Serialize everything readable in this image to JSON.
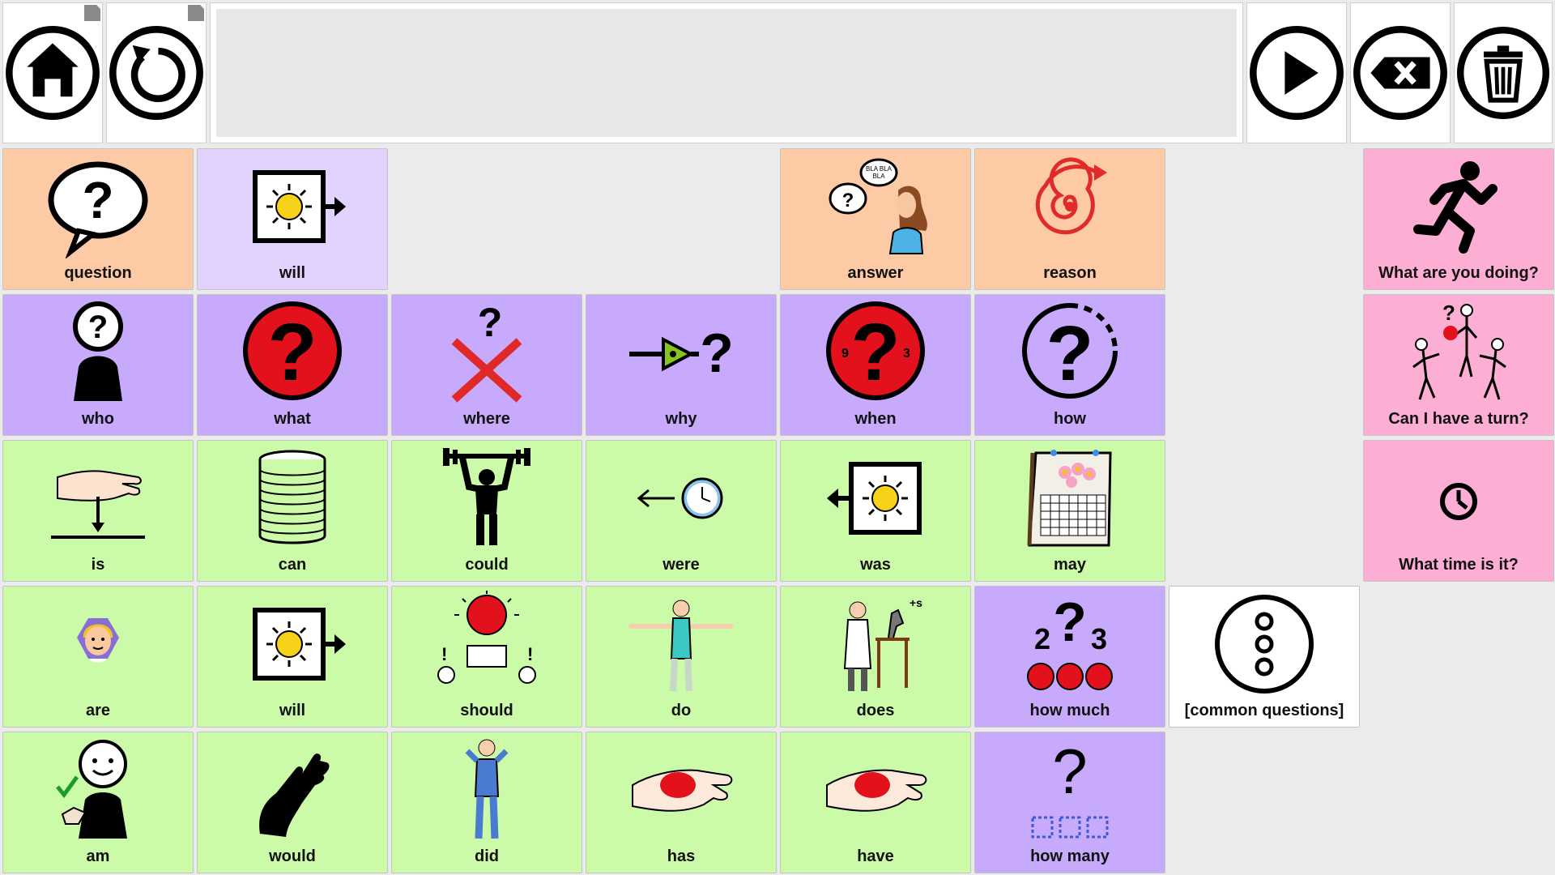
{
  "toolbar": {
    "home": "home-icon",
    "undo": "undo-icon",
    "speak": "play-icon",
    "backspace": "backspace-icon",
    "clear": "trash-icon"
  },
  "message": {
    "text": ""
  },
  "colors": {
    "orange": "#fdcaa6",
    "lilac": "#e2d3fe",
    "purple": "#c8aafd",
    "green": "#cbfba9",
    "pink": "#fdaed4",
    "white": "#ffffff"
  },
  "grid": [
    {
      "label": "question",
      "icon": "speech-bubble-question-icon",
      "color": "orange"
    },
    {
      "label": "will",
      "icon": "sun-future-arrow-icon",
      "color": "lilac"
    },
    {
      "label": "answer",
      "icon": "girl-answer-icon",
      "color": "orange"
    },
    {
      "label": "reason",
      "icon": "spiral-icon",
      "color": "orange"
    },
    {
      "label": "What are you doing?",
      "icon": "running-person-icon",
      "color": "pink"
    },
    {
      "label": "who",
      "icon": "person-question-icon",
      "color": "purple"
    },
    {
      "label": "what",
      "icon": "red-question-icon",
      "color": "purple"
    },
    {
      "label": "where",
      "icon": "cross-question-icon",
      "color": "purple"
    },
    {
      "label": "why",
      "icon": "reason-arrow-question-icon",
      "color": "purple"
    },
    {
      "label": "when",
      "icon": "clock-question-icon",
      "color": "purple"
    },
    {
      "label": "how",
      "icon": "dashed-question-icon",
      "color": "purple"
    },
    {
      "label": "Can I have a turn?",
      "icon": "ball-turn-icon",
      "color": "pink"
    },
    {
      "label": "is",
      "icon": "hand-drop-icon",
      "color": "green"
    },
    {
      "label": "can",
      "icon": "can-stack-icon",
      "color": "green"
    },
    {
      "label": "could",
      "icon": "weightlifter-icon",
      "color": "green"
    },
    {
      "label": "were",
      "icon": "clock-past-arrow-icon",
      "color": "green"
    },
    {
      "label": "was",
      "icon": "sun-past-arrow-icon",
      "color": "green"
    },
    {
      "label": "may",
      "icon": "calendar-icon",
      "color": "green"
    },
    {
      "label": "What time is it?",
      "icon": "clock-icon",
      "color": "pink"
    },
    {
      "label": "are",
      "icon": "person-arms-up-icon",
      "color": "green"
    },
    {
      "label": "will",
      "icon": "sun-future-arrow-icon",
      "color": "green"
    },
    {
      "label": "should",
      "icon": "should-people-icon",
      "color": "green"
    },
    {
      "label": "do",
      "icon": "gymnast-icon",
      "color": "green"
    },
    {
      "label": "does",
      "icon": "scientist-icon",
      "color": "green"
    },
    {
      "label": "how much",
      "icon": "how-much-icon",
      "color": "purple"
    },
    {
      "label": "[common questions]",
      "icon": "more-dots-icon",
      "color": "white"
    },
    {
      "label": "am",
      "icon": "person-self-icon",
      "color": "green"
    },
    {
      "label": "would",
      "icon": "hand-icon",
      "color": "green"
    },
    {
      "label": "did",
      "icon": "standing-man-icon",
      "color": "green"
    },
    {
      "label": "has",
      "icon": "hand-ball-icon",
      "color": "green"
    },
    {
      "label": "have",
      "icon": "hand-ball-icon",
      "color": "green"
    },
    {
      "label": "how many",
      "icon": "how-many-icon",
      "color": "purple"
    }
  ]
}
